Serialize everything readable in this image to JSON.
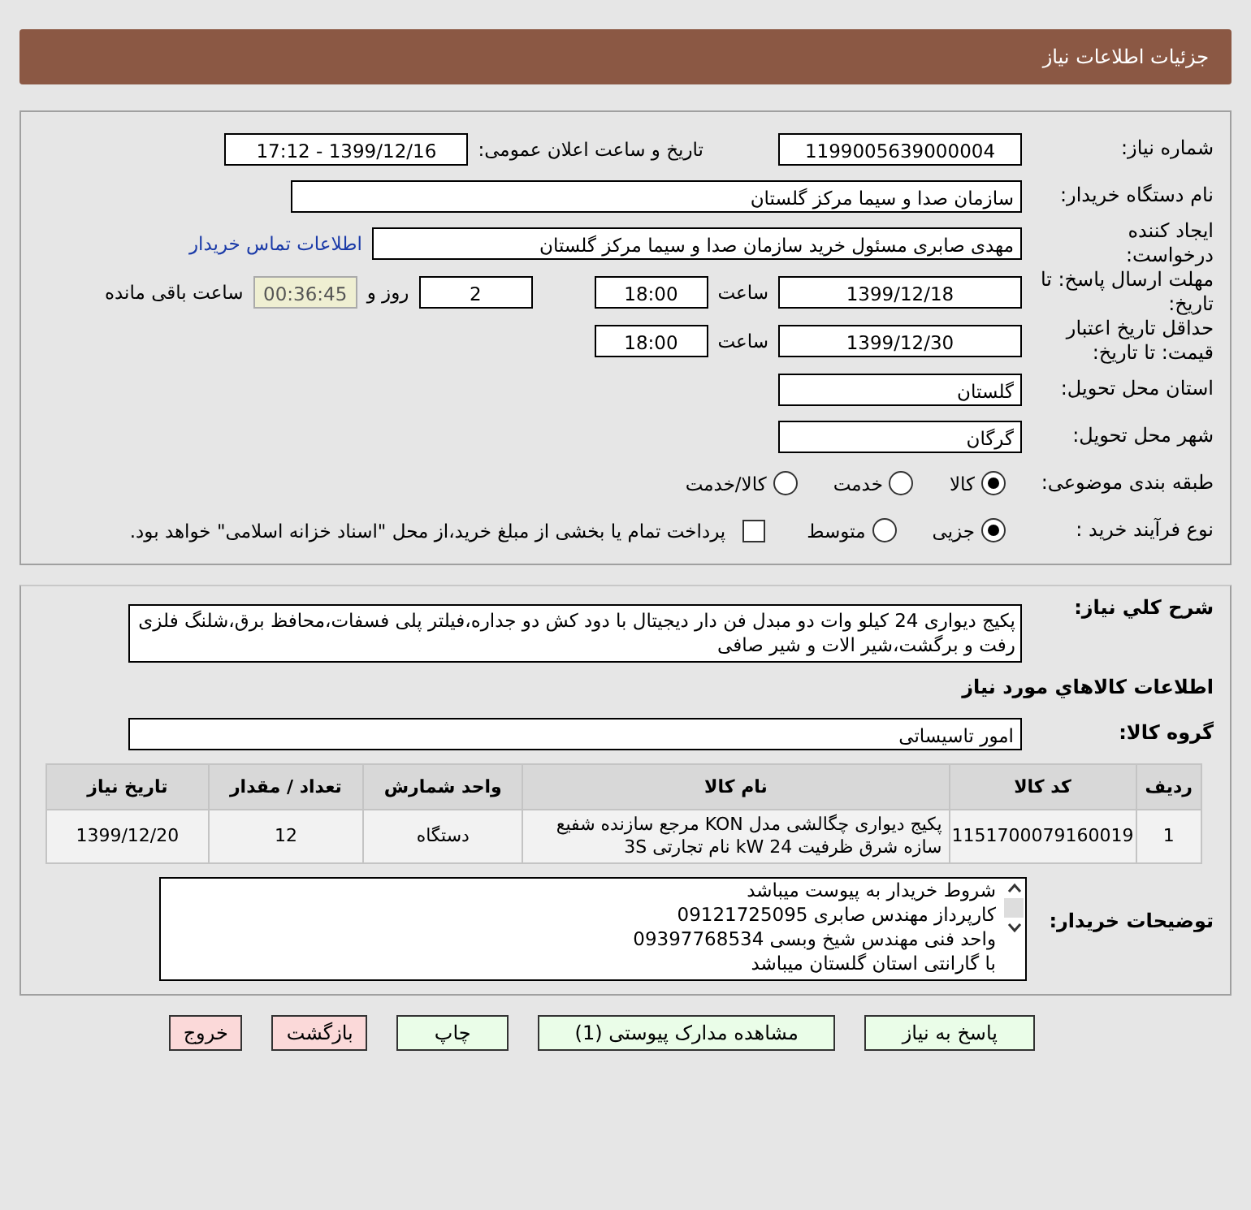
{
  "header": {
    "title": "جزئیات اطلاعات نیاز"
  },
  "need_number": {
    "label": "شماره نیاز:",
    "value": "1199005639000004"
  },
  "announce": {
    "label": "تاریخ و ساعت اعلان عمومی:",
    "value": "1399/12/16 - 17:12"
  },
  "buyer_org": {
    "label": "نام دستگاه خریدار:",
    "value": "سازمان صدا و سیما مرکز گلستان"
  },
  "requester": {
    "label": "ایجاد کننده درخواست:",
    "value": "مهدی صابری مسئول خرید سازمان صدا و سیما مرکز گلستان",
    "link": "اطلاعات تماس خریدار"
  },
  "reply_deadline": {
    "label": "مهلت ارسال پاسخ: تا تاریخ:",
    "date": "1399/12/18",
    "time_label": "ساعت",
    "time": "18:00",
    "days": "2",
    "days_label": "روز و",
    "remaining": "00:36:45",
    "remaining_label": "ساعت باقی مانده"
  },
  "price_validity": {
    "label": "حداقل تاریخ اعتبار قیمت: تا تاریخ:",
    "date": "1399/12/30",
    "time_label": "ساعت",
    "time": "18:00"
  },
  "province": {
    "label": "استان محل تحویل:",
    "value": "گلستان"
  },
  "city": {
    "label": "شهر محل تحویل:",
    "value": "گرگان"
  },
  "category": {
    "label": "طبقه بندی موضوعی:",
    "options": [
      {
        "label": "کالا",
        "selected": true
      },
      {
        "label": "خدمت",
        "selected": false
      },
      {
        "label": "کالا/خدمت",
        "selected": false
      }
    ]
  },
  "process": {
    "label": "نوع فرآیند خرید :",
    "options": [
      {
        "label": "جزیی",
        "selected": true
      },
      {
        "label": "متوسط",
        "selected": false
      }
    ],
    "payment": {
      "label": "پرداخت تمام یا بخشی از مبلغ خرید،از محل \"اسناد خزانه اسلامی\" خواهد بود.",
      "checked": false
    }
  },
  "description": {
    "label": "شرح كلي نياز:",
    "value": "پکیج دیواری 24 کیلو وات دو مبدل فن دار دیجیتال با دود کش دو جداره،فیلتر پلی فسفات،محافظ برق،شلنگ فلزی رفت و برگشت،شیر الات و شیر صافی"
  },
  "goods_heading": "اطلاعات كالاهاي مورد نياز",
  "goods_group": {
    "label": "گروه کالا:",
    "value": "امور تاسیساتی"
  },
  "table": {
    "columns": [
      "ردیف",
      "کد کالا",
      "نام کالا",
      "واحد شمارش",
      "تعداد / مقدار",
      "تاریخ نیاز"
    ],
    "rows": [
      [
        "1",
        "1151700079160019",
        "پکیج دیواری چگالشی مدل KON مرجع سازنده شفیع سازه شرق ظرفیت 24 kW نام تجارتی 3S",
        "دستگاه",
        "12",
        "1399/12/20"
      ]
    ]
  },
  "buyer_notes": {
    "label": "توضیحات خریدار:",
    "lines": [
      "شروط خریدار به پیوست میباشد",
      "کارپرداز مهندس صابری 09121725095",
      "واحد فنی مهندس شیخ وبسی 09397768534",
      "با گارانتی استان گلستان میباشد"
    ]
  },
  "buttons": [
    {
      "label": "پاسخ به نیاز",
      "kind": "action"
    },
    {
      "label": "مشاهده مدارک پیوستی (1)",
      "kind": "action"
    },
    {
      "label": "چاپ",
      "kind": "action"
    },
    {
      "label": "بازگشت",
      "kind": "exit"
    },
    {
      "label": "خروج",
      "kind": "exit"
    }
  ]
}
